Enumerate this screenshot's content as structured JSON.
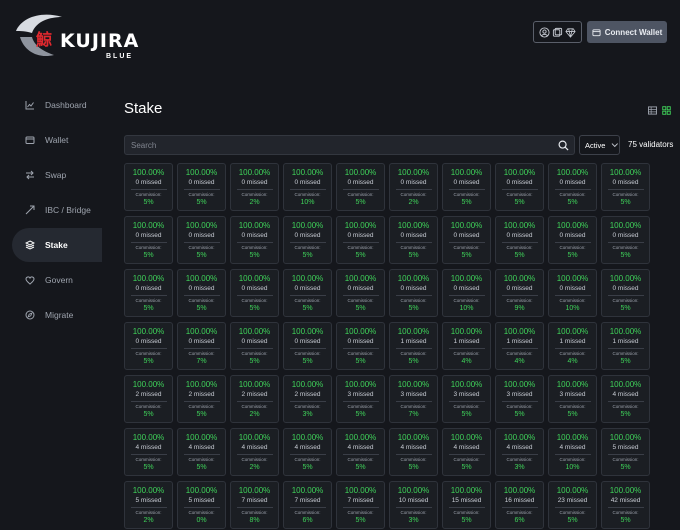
{
  "brand": {
    "name": "KUJIRA",
    "sub": "BLUE",
    "kanji": "鯨"
  },
  "header": {
    "connect_label": "Connect Wallet"
  },
  "sidebar": {
    "items": [
      {
        "label": "Dashboard",
        "icon": "chart-icon",
        "active": false
      },
      {
        "label": "Wallet",
        "icon": "wallet-icon",
        "active": false
      },
      {
        "label": "Swap",
        "icon": "swap-icon",
        "active": false
      },
      {
        "label": "IBC / Bridge",
        "icon": "bridge-icon",
        "active": false
      },
      {
        "label": "Stake",
        "icon": "layers-icon",
        "active": true
      },
      {
        "label": "Govern",
        "icon": "govern-icon",
        "active": false
      },
      {
        "label": "Migrate",
        "icon": "compass-icon",
        "active": false
      }
    ]
  },
  "main": {
    "title": "Stake",
    "search_placeholder": "Search",
    "filter_value": "Active",
    "validator_count": "75 validators",
    "commission_label": "Commission:"
  },
  "validators": [
    {
      "uptime": "100.00%",
      "missed": "0 missed",
      "commission": "5%"
    },
    {
      "uptime": "100.00%",
      "missed": "0 missed",
      "commission": "5%"
    },
    {
      "uptime": "100.00%",
      "missed": "0 missed",
      "commission": "2%"
    },
    {
      "uptime": "100.00%",
      "missed": "0 missed",
      "commission": "10%"
    },
    {
      "uptime": "100.00%",
      "missed": "0 missed",
      "commission": "5%"
    },
    {
      "uptime": "100.00%",
      "missed": "0 missed",
      "commission": "2%"
    },
    {
      "uptime": "100.00%",
      "missed": "0 missed",
      "commission": "5%"
    },
    {
      "uptime": "100.00%",
      "missed": "0 missed",
      "commission": "5%"
    },
    {
      "uptime": "100.00%",
      "missed": "0 missed",
      "commission": "5%"
    },
    {
      "uptime": "100.00%",
      "missed": "0 missed",
      "commission": "5%"
    },
    {
      "uptime": "100.00%",
      "missed": "0 missed",
      "commission": "5%"
    },
    {
      "uptime": "100.00%",
      "missed": "0 missed",
      "commission": "5%"
    },
    {
      "uptime": "100.00%",
      "missed": "0 missed",
      "commission": "5%"
    },
    {
      "uptime": "100.00%",
      "missed": "0 missed",
      "commission": "5%"
    },
    {
      "uptime": "100.00%",
      "missed": "0 missed",
      "commission": "5%"
    },
    {
      "uptime": "100.00%",
      "missed": "0 missed",
      "commission": "5%"
    },
    {
      "uptime": "100.00%",
      "missed": "0 missed",
      "commission": "5%"
    },
    {
      "uptime": "100.00%",
      "missed": "0 missed",
      "commission": "5%"
    },
    {
      "uptime": "100.00%",
      "missed": "0 missed",
      "commission": "5%"
    },
    {
      "uptime": "100.00%",
      "missed": "0 missed",
      "commission": "5%"
    },
    {
      "uptime": "100.00%",
      "missed": "0 missed",
      "commission": "5%"
    },
    {
      "uptime": "100.00%",
      "missed": "0 missed",
      "commission": "5%"
    },
    {
      "uptime": "100.00%",
      "missed": "0 missed",
      "commission": "5%"
    },
    {
      "uptime": "100.00%",
      "missed": "0 missed",
      "commission": "5%"
    },
    {
      "uptime": "100.00%",
      "missed": "0 missed",
      "commission": "5%"
    },
    {
      "uptime": "100.00%",
      "missed": "0 missed",
      "commission": "5%"
    },
    {
      "uptime": "100.00%",
      "missed": "0 missed",
      "commission": "10%"
    },
    {
      "uptime": "100.00%",
      "missed": "0 missed",
      "commission": "9%"
    },
    {
      "uptime": "100.00%",
      "missed": "0 missed",
      "commission": "10%"
    },
    {
      "uptime": "100.00%",
      "missed": "0 missed",
      "commission": "5%"
    },
    {
      "uptime": "100.00%",
      "missed": "0 missed",
      "commission": "5%"
    },
    {
      "uptime": "100.00%",
      "missed": "0 missed",
      "commission": "7%"
    },
    {
      "uptime": "100.00%",
      "missed": "0 missed",
      "commission": "5%"
    },
    {
      "uptime": "100.00%",
      "missed": "0 missed",
      "commission": "5%"
    },
    {
      "uptime": "100.00%",
      "missed": "0 missed",
      "commission": "5%"
    },
    {
      "uptime": "100.00%",
      "missed": "1 missed",
      "commission": "5%"
    },
    {
      "uptime": "100.00%",
      "missed": "1 missed",
      "commission": "4%"
    },
    {
      "uptime": "100.00%",
      "missed": "1 missed",
      "commission": "4%"
    },
    {
      "uptime": "100.00%",
      "missed": "1 missed",
      "commission": "4%"
    },
    {
      "uptime": "100.00%",
      "missed": "1 missed",
      "commission": "5%"
    },
    {
      "uptime": "100.00%",
      "missed": "2 missed",
      "commission": "5%"
    },
    {
      "uptime": "100.00%",
      "missed": "2 missed",
      "commission": "5%"
    },
    {
      "uptime": "100.00%",
      "missed": "2 missed",
      "commission": "2%"
    },
    {
      "uptime": "100.00%",
      "missed": "2 missed",
      "commission": "3%"
    },
    {
      "uptime": "100.00%",
      "missed": "3 missed",
      "commission": "5%"
    },
    {
      "uptime": "100.00%",
      "missed": "3 missed",
      "commission": "7%"
    },
    {
      "uptime": "100.00%",
      "missed": "3 missed",
      "commission": "5%"
    },
    {
      "uptime": "100.00%",
      "missed": "3 missed",
      "commission": "5%"
    },
    {
      "uptime": "100.00%",
      "missed": "3 missed",
      "commission": "5%"
    },
    {
      "uptime": "100.00%",
      "missed": "4 missed",
      "commission": "5%"
    },
    {
      "uptime": "100.00%",
      "missed": "4 missed",
      "commission": "5%"
    },
    {
      "uptime": "100.00%",
      "missed": "4 missed",
      "commission": "5%"
    },
    {
      "uptime": "100.00%",
      "missed": "4 missed",
      "commission": "2%"
    },
    {
      "uptime": "100.00%",
      "missed": "4 missed",
      "commission": "5%"
    },
    {
      "uptime": "100.00%",
      "missed": "4 missed",
      "commission": "5%"
    },
    {
      "uptime": "100.00%",
      "missed": "4 missed",
      "commission": "5%"
    },
    {
      "uptime": "100.00%",
      "missed": "4 missed",
      "commission": "5%"
    },
    {
      "uptime": "100.00%",
      "missed": "4 missed",
      "commission": "3%"
    },
    {
      "uptime": "100.00%",
      "missed": "4 missed",
      "commission": "10%"
    },
    {
      "uptime": "100.00%",
      "missed": "5 missed",
      "commission": "5%"
    },
    {
      "uptime": "100.00%",
      "missed": "5 missed",
      "commission": "2%"
    },
    {
      "uptime": "100.00%",
      "missed": "5 missed",
      "commission": "0%"
    },
    {
      "uptime": "100.00%",
      "missed": "7 missed",
      "commission": "8%"
    },
    {
      "uptime": "100.00%",
      "missed": "7 missed",
      "commission": "6%"
    },
    {
      "uptime": "100.00%",
      "missed": "7 missed",
      "commission": "5%"
    },
    {
      "uptime": "100.00%",
      "missed": "10 missed",
      "commission": "3%"
    },
    {
      "uptime": "100.00%",
      "missed": "15 missed",
      "commission": "5%"
    },
    {
      "uptime": "100.00%",
      "missed": "16 missed",
      "commission": "6%"
    },
    {
      "uptime": "100.00%",
      "missed": "23 missed",
      "commission": "5%"
    },
    {
      "uptime": "100.00%",
      "missed": "42 missed",
      "commission": "5%"
    }
  ]
}
